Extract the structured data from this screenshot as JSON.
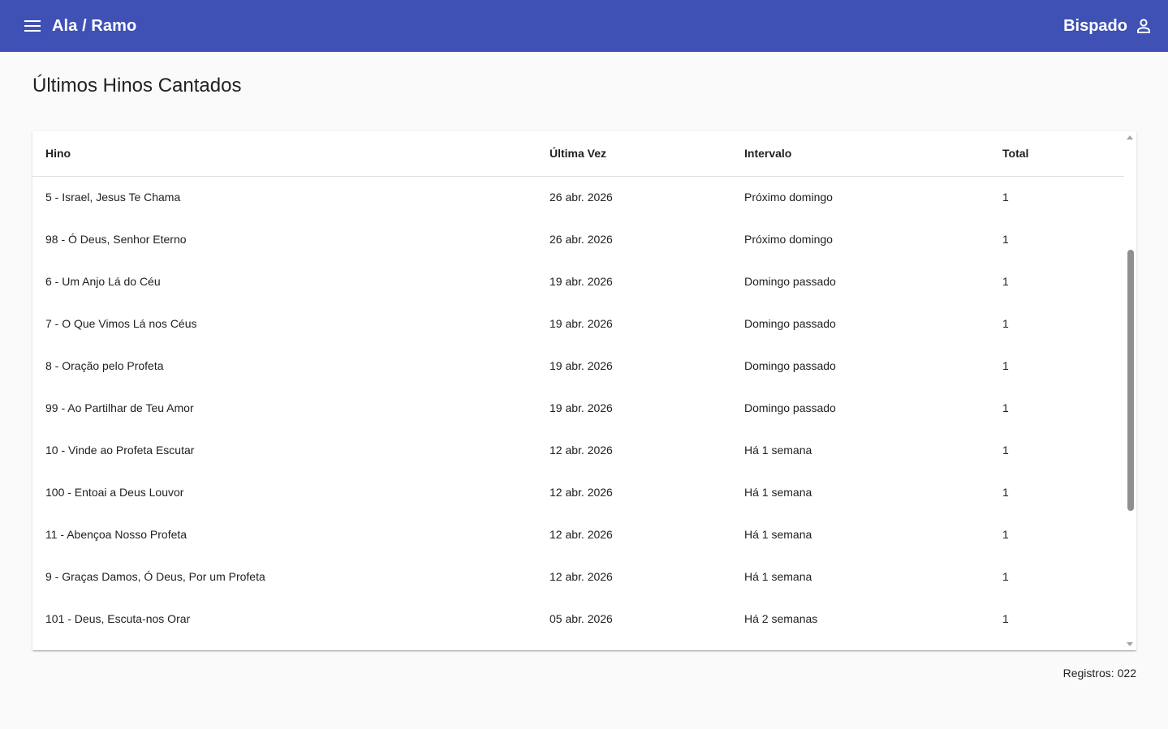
{
  "toolbar": {
    "title": "Ala / Ramo",
    "user_label": "Bispado",
    "menu_icon": "menu-icon",
    "user_icon": "person-icon",
    "color": "#3f51b5"
  },
  "page": {
    "title": "Últimos Hinos Cantados"
  },
  "table": {
    "columns": [
      "Hino",
      "Última Vez",
      "Intervalo",
      "Total"
    ],
    "rows": [
      [
        "5 - Israel, Jesus Te Chama",
        "26 abr. 2026",
        "Próximo domingo",
        "1"
      ],
      [
        "98 - Ó Deus, Senhor Eterno",
        "26 abr. 2026",
        "Próximo domingo",
        "1"
      ],
      [
        "6 - Um Anjo Lá do Céu",
        "19 abr. 2026",
        "Domingo passado",
        "1"
      ],
      [
        "7 - O Que Vimos Lá nos Céus",
        "19 abr. 2026",
        "Domingo passado",
        "1"
      ],
      [
        "8 - Oração pelo Profeta",
        "19 abr. 2026",
        "Domingo passado",
        "1"
      ],
      [
        "99 - Ao Partilhar de Teu Amor",
        "19 abr. 2026",
        "Domingo passado",
        "1"
      ],
      [
        "10 - Vinde ao Profeta Escutar",
        "12 abr. 2026",
        "Há 1 semana",
        "1"
      ],
      [
        "100 - Entoai a Deus Louvor",
        "12 abr. 2026",
        "Há 1 semana",
        "1"
      ],
      [
        "11 - Abençoa Nosso Profeta",
        "12 abr. 2026",
        "Há 1 semana",
        "1"
      ],
      [
        "9 - Graças Damos, Ó Deus, Por um Profeta",
        "12 abr. 2026",
        "Há 1 semana",
        "1"
      ],
      [
        "101 - Deus, Escuta-nos Orar",
        "05 abr. 2026",
        "Há 2 semanas",
        "1"
      ]
    ]
  },
  "footer": {
    "label": "Registros:",
    "count": "022"
  }
}
